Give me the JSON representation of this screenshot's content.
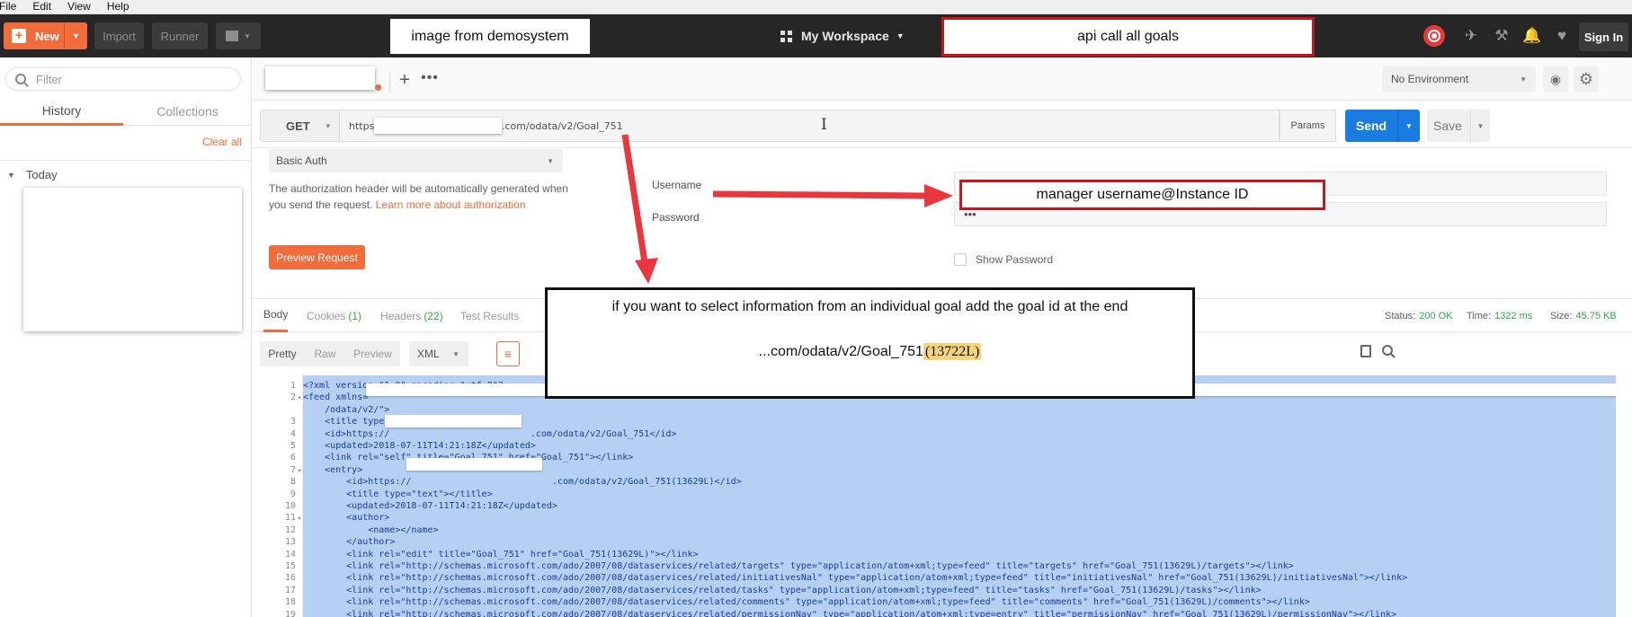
{
  "menu": [
    "File",
    "Edit",
    "View",
    "Help"
  ],
  "topbar": {
    "new_label": "New",
    "import_label": "Import",
    "runner_label": "Runner",
    "workspace_label": "My Workspace",
    "signin_label": "Sign In",
    "callout_left": "image from demosystem",
    "callout_right": "api call all goals"
  },
  "sidebar": {
    "filter_placeholder": "Filter",
    "tab_history": "History",
    "tab_collections": "Collections",
    "clear_all": "Clear all",
    "group_label": "Today"
  },
  "environment": {
    "selected": "No Environment"
  },
  "request": {
    "method": "GET",
    "url_prefix": "https:/",
    "url_suffix": ".com/odata/v2/Goal_751",
    "params_label": "Params",
    "send_label": "Send",
    "save_label": "Save"
  },
  "auth": {
    "type": "Basic Auth",
    "description": "The authorization header will be automatically generated when you send the request. ",
    "learn_more": "Learn more about authorization",
    "preview_label": "Preview Request",
    "username_label": "Username",
    "password_label": "Password",
    "password_value": "•••",
    "show_password": "Show Password"
  },
  "response": {
    "tabs": {
      "body": "Body",
      "cookies": "Cookies",
      "cookies_count": "(1)",
      "headers": "Headers",
      "headers_count": "(22)",
      "tests": "Test Results"
    },
    "status_label": "Status:",
    "status_value": "200 OK",
    "time_label": "Time:",
    "time_value": "1322 ms",
    "size_label": "Size:",
    "size_value": "45.75 KB",
    "view_modes": [
      "Pretty",
      "Raw",
      "Preview"
    ],
    "format": "XML"
  },
  "code_lines": [
    {
      "n": "1",
      "f": "",
      "t": "<?xml version=\"1.0\" encoding=\"utf-8\"?>"
    },
    {
      "n": "2",
      "f": "▾",
      "t": "<feed xmlns=\""
    },
    {
      "n": "",
      "f": "",
      "t": "    /odata/v2/\">"
    },
    {
      "n": "3",
      "f": "",
      "t": "    <title type=\"text\">Goal 751</title>"
    },
    {
      "n": "4",
      "f": "",
      "t": "    <id>https://                          .com/odata/v2/Goal_751</id>"
    },
    {
      "n": "5",
      "f": "",
      "t": "    <updated>2018-07-11T14:21:18Z</updated>"
    },
    {
      "n": "6",
      "f": "",
      "t": "    <link rel=\"self\" title=\"Goal_751\" href=\"Goal_751\"></link>"
    },
    {
      "n": "7",
      "f": "▾",
      "t": "    <entry>"
    },
    {
      "n": "8",
      "f": "",
      "t": "        <id>https://                          .com/odata/v2/Goal_751(13629L)</id>"
    },
    {
      "n": "9",
      "f": "",
      "t": "        <title type=\"text\"></title>"
    },
    {
      "n": "10",
      "f": "",
      "t": "        <updated>2018-07-11T14:21:18Z</updated>"
    },
    {
      "n": "11",
      "f": "▾",
      "t": "        <author>"
    },
    {
      "n": "12",
      "f": "",
      "t": "            <name></name>"
    },
    {
      "n": "13",
      "f": "",
      "t": "        </author>"
    },
    {
      "n": "14",
      "f": "",
      "t": "        <link rel=\"edit\" title=\"Goal_751\" href=\"Goal_751(13629L)\"></link>"
    },
    {
      "n": "15",
      "f": "",
      "t": "        <link rel=\"http://schemas.microsoft.com/ado/2007/08/dataservices/related/targets\" type=\"application/atom+xml;type=feed\" title=\"targets\" href=\"Goal_751(13629L)/targets\"></link>"
    },
    {
      "n": "16",
      "f": "",
      "t": "        <link rel=\"http://schemas.microsoft.com/ado/2007/08/dataservices/related/initiativesNal\" type=\"application/atom+xml;type=feed\" title=\"initiativesNal\" href=\"Goal_751(13629L)/initiativesNal\"></link>"
    },
    {
      "n": "17",
      "f": "",
      "t": "        <link rel=\"http://schemas.microsoft.com/ado/2007/08/dataservices/related/tasks\" type=\"application/atom+xml;type=feed\" title=\"tasks\" href=\"Goal_751(13629L)/tasks\"></link>"
    },
    {
      "n": "18",
      "f": "",
      "t": "        <link rel=\"http://schemas.microsoft.com/ado/2007/08/dataservices/related/comments\" type=\"application/atom+xml;type=feed\" title=\"comments\" href=\"Goal_751(13629L)/comments\"></link>"
    },
    {
      "n": "19",
      "f": "",
      "t": "        <link rel=\"http://schemas.microsoft.com/ado/2007/08/dataservices/related/permissionNav\" type=\"application/atom+xml;type=entry\" title=\"permissionNav\" href=\"Goal_751(13629L)/permissionNav\"></link>"
    }
  ],
  "annotations": {
    "username_callout": "manager username@Instance ID",
    "goal_hint_line1": "if you want to select information from an individual goal add the goal id at the end",
    "goal_hint_line2_prefix": "...com/odata/v2/Goal_751",
    "goal_hint_line2_id": "(13722L)"
  },
  "colors": {
    "accent": "#f26b3a",
    "send": "#1a7be0",
    "annotation_red": "#e8383d",
    "selection": "#b5d0f3"
  }
}
